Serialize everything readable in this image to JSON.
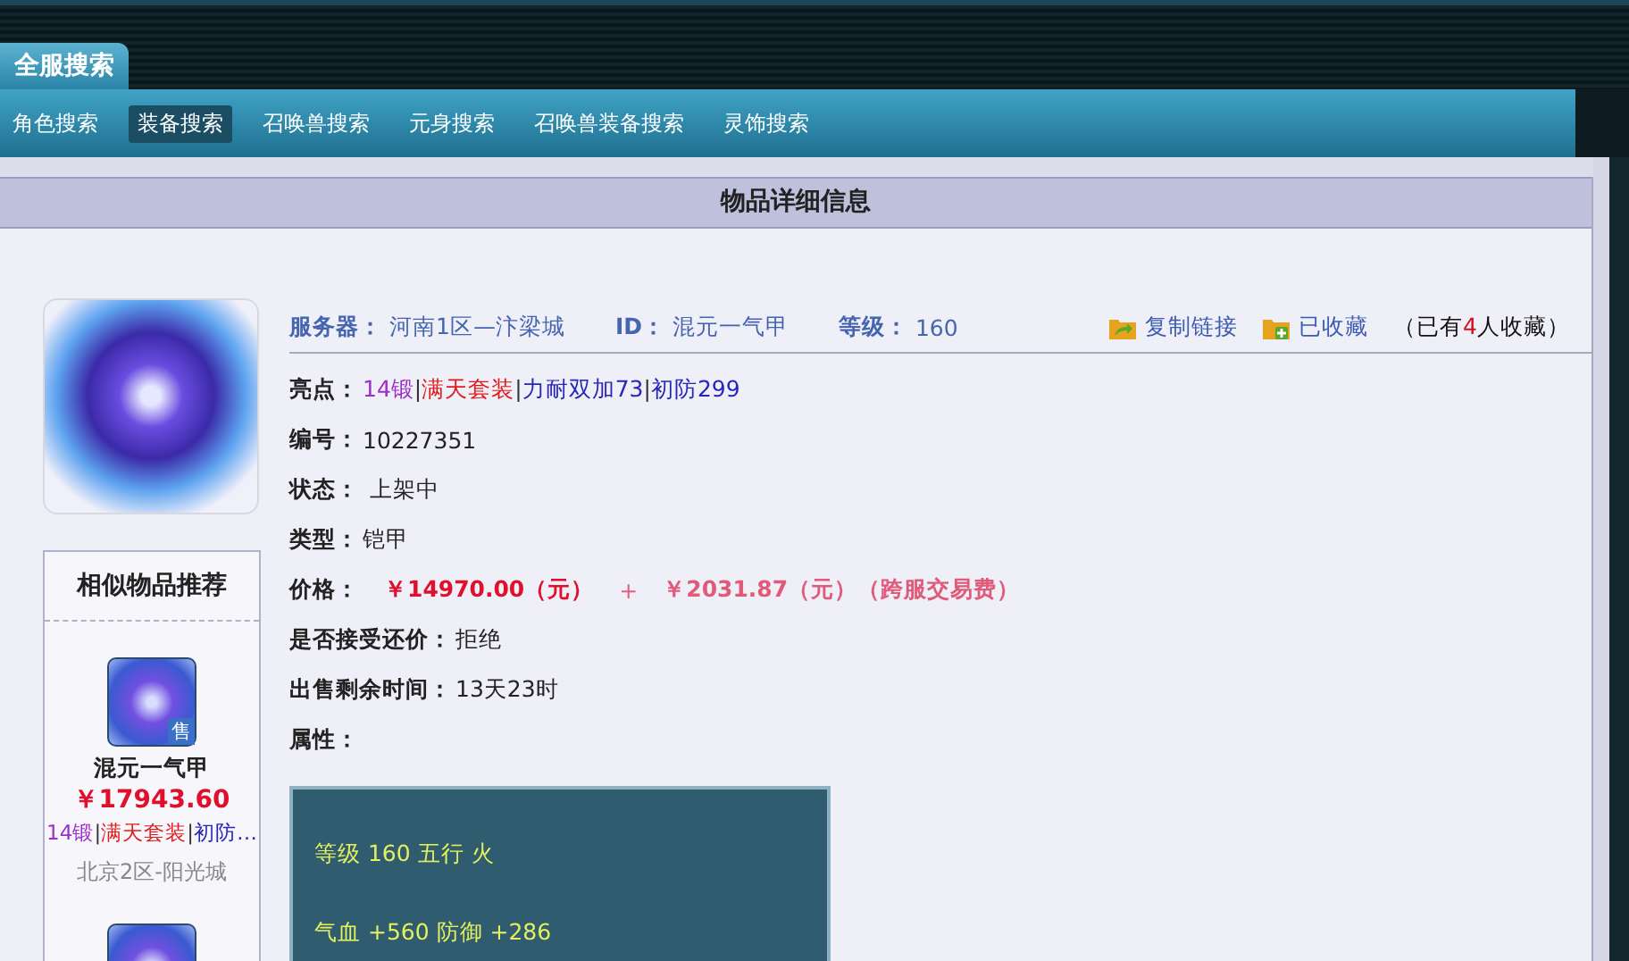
{
  "top_tab": {
    "label": "全服搜索"
  },
  "nav": [
    {
      "label": "角色搜索",
      "selected": false
    },
    {
      "label": "装备搜索",
      "selected": true
    },
    {
      "label": "召唤兽搜索",
      "selected": false
    },
    {
      "label": "元身搜索",
      "selected": false
    },
    {
      "label": "召唤兽装备搜索",
      "selected": false
    },
    {
      "label": "灵饰搜索",
      "selected": false
    }
  ],
  "panel_title": "物品详细信息",
  "summary": {
    "server_label": "服务器：",
    "server": "河南1区—汴梁城",
    "id_label": "ID：",
    "id": "混元一气甲",
    "level_label": "等级：",
    "level_value": "160"
  },
  "actions": [
    {
      "kind": "copy",
      "label": "复制链接"
    },
    {
      "kind": "favorite",
      "label": "已收藏"
    }
  ],
  "favorite_count": {
    "prefix": "（已有",
    "count": "4",
    "suffix": "人收藏）"
  },
  "highlights_label": "亮点：",
  "highlights": [
    {
      "text": "14锻",
      "color": "#9b2fc9"
    },
    {
      "text": "|",
      "color": "#333333"
    },
    {
      "text": "满天套装",
      "color": "#e01b1b"
    },
    {
      "text": "|",
      "color": "#333333"
    },
    {
      "text": "力耐双加73",
      "color": "#2626b8"
    },
    {
      "text": "|",
      "color": "#333333"
    },
    {
      "text": "初防299",
      "color": "#2626b8"
    }
  ],
  "fields": [
    {
      "label": "编号：",
      "value": "10227351"
    },
    {
      "label": "状态：",
      "value": " 上架中"
    },
    {
      "label": "类型：",
      "value": "铠甲"
    }
  ],
  "price": {
    "label": "价格：",
    "amount": "￥14970.00（元）",
    "plus": "+",
    "fee": "￥2031.87（元）（跨服交易费）"
  },
  "fields2": [
    {
      "label": "是否接受还价：",
      "value": "拒绝"
    },
    {
      "label": "出售剩余时间：",
      "value": "13天23时"
    }
  ],
  "attributes_label": "属性：",
  "attributes": [
    "等级 160 五行 火",
    "气血 +560 防御 +286"
  ],
  "similar": {
    "title": "相似物品推荐",
    "items": [
      {
        "badge": "售",
        "name": "混元一气甲",
        "price": "￥17943.60",
        "tags": [
          {
            "text": "14锻",
            "color": "#9b2fc9"
          },
          {
            "text": "|",
            "color": "#333333"
          },
          {
            "text": "满天套装",
            "color": "#e01b1b"
          },
          {
            "text": "|",
            "color": "#333333"
          },
          {
            "text": "初防…",
            "color": "#2626b8"
          }
        ],
        "server": "北京2区-阳光城"
      }
    ],
    "more_below": true
  }
}
